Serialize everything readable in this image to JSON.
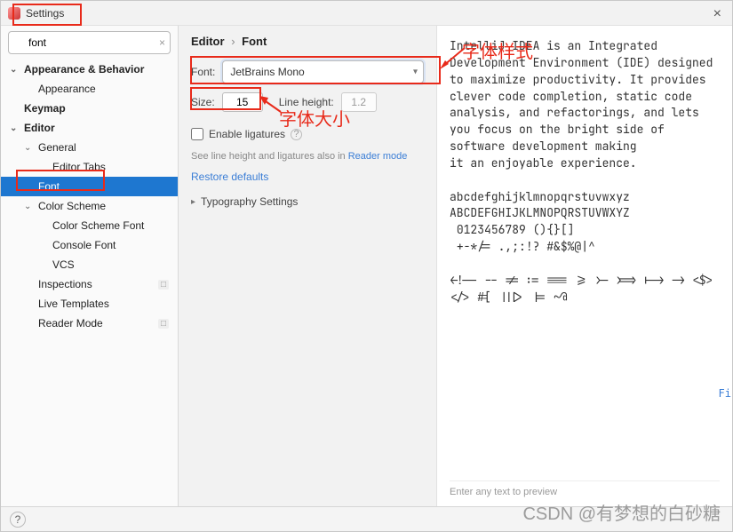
{
  "title": "Settings",
  "search": {
    "value": "font"
  },
  "tree": {
    "appearance_behavior": "Appearance & Behavior",
    "appearance": "Appearance",
    "keymap": "Keymap",
    "editor": "Editor",
    "general": "General",
    "editor_tabs": "Editor Tabs",
    "font": "Font",
    "color_scheme": "Color Scheme",
    "color_scheme_font": "Color Scheme Font",
    "console_font": "Console Font",
    "vcs": "VCS",
    "inspections": "Inspections",
    "live_templates": "Live Templates",
    "reader_mode": "Reader Mode",
    "tag": "□"
  },
  "breadcrumb": {
    "editor": "Editor",
    "font": "Font"
  },
  "form": {
    "font_label": "Font:",
    "font_value": "JetBrains Mono",
    "size_label": "Size:",
    "size_value": "15",
    "line_height_label": "Line height:",
    "line_height_value": "1.2",
    "ligatures_label": "Enable ligatures",
    "hint_prefix": "See line height and ligatures also in ",
    "hint_link": "Reader mode",
    "restore": "Restore defaults",
    "typography": "Typography Settings"
  },
  "preview": {
    "text": "IntelliJ IDEA is an Integrated\nDevelopment Environment (IDE) designed\nto maximize productivity. It provides\nclever code completion, static code\nanalysis, and refactorings, and lets\nyou focus on the bright side of\nsoftware development making\nit an enjoyable experience.\n\nabcdefghijklmnopqrstuvwxyz\nABCDEFGHIJKLMNOPQRSTUVWXYZ\n 0123456789 (){}[]\n +-*/= .,;:!? #&$%@|^\n\n<!-- -- != := === >= >- >=> |-> -> <$>\n</> #[ |||> |= ~@",
    "enter_hint": "Enter any text to preview"
  },
  "annotations": {
    "style_label": "字体样式",
    "size_label": "字体大小"
  },
  "watermark": "CSDN @有梦想的白砂糖",
  "rightedge": "Fi"
}
